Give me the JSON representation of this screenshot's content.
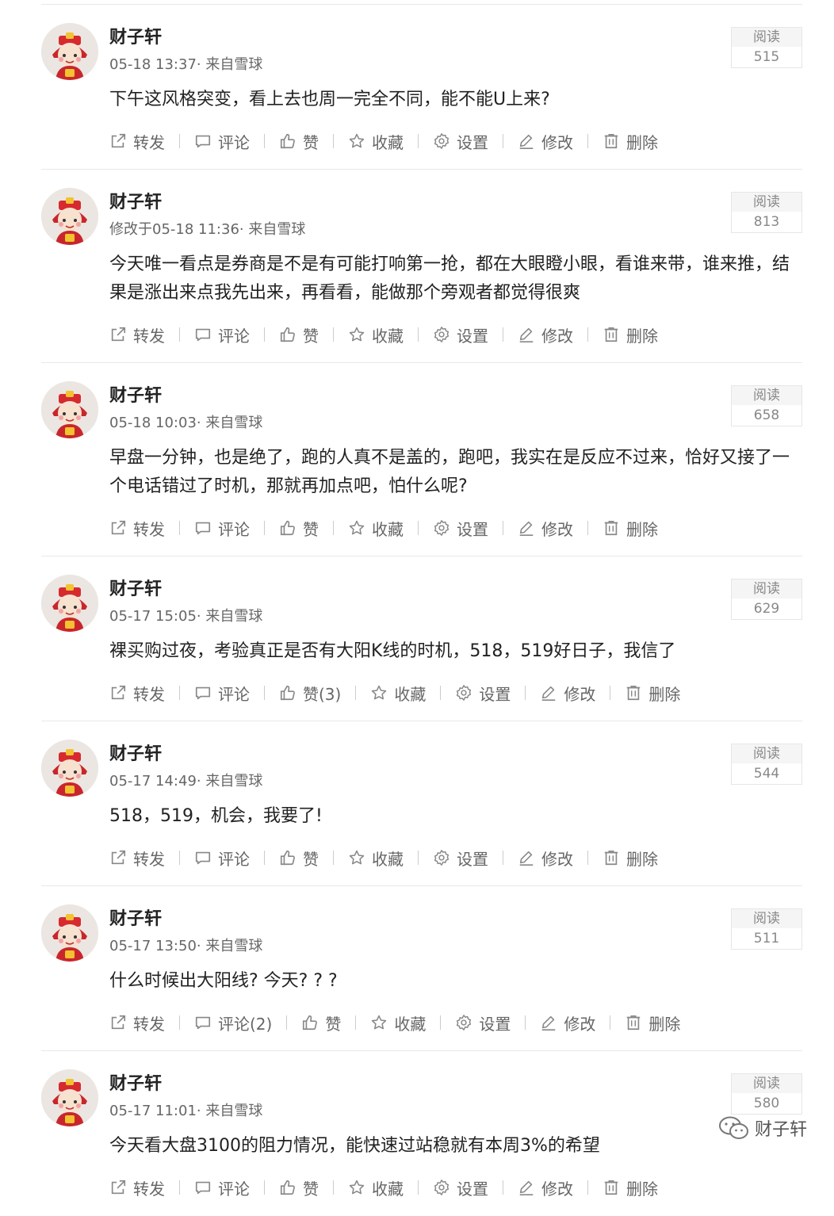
{
  "actions": {
    "forward": "转发",
    "comment": "评论",
    "like": "赞",
    "favorite": "收藏",
    "settings": "设置",
    "edit": "修改",
    "delete": "删除"
  },
  "reads_label": "阅读",
  "watermark": "财子轩",
  "posts": [
    {
      "author": "财子轩",
      "time": "05-18 13:37",
      "source": "· 来自雪球",
      "reads": "515",
      "content": "下午这风格突变，看上去也周一完全不同，能不能U上来?",
      "comment_label": "评论",
      "like_label": "赞"
    },
    {
      "author": "财子轩",
      "time": "修改于05-18 11:36",
      "source": "· 来自雪球",
      "reads": "813",
      "content": "今天唯一看点是券商是不是有可能打响第一抢，都在大眼瞪小眼，看谁来带，谁来推，结果是涨出来点我先出来，再看看，能做那个旁观者都觉得很爽",
      "comment_label": "评论",
      "like_label": "赞"
    },
    {
      "author": "财子轩",
      "time": "05-18 10:03",
      "source": "· 来自雪球",
      "reads": "658",
      "content": "早盘一分钟，也是绝了，跑的人真不是盖的，跑吧，我实在是反应不过来，恰好又接了一个电话错过了时机，那就再加点吧，怕什么呢?",
      "comment_label": "评论",
      "like_label": "赞"
    },
    {
      "author": "财子轩",
      "time": "05-17 15:05",
      "source": "· 来自雪球",
      "reads": "629",
      "content": "裸买购过夜，考验真正是否有大阳K线的时机，518，519好日子，我信了",
      "comment_label": "评论",
      "like_label": "赞(3)"
    },
    {
      "author": "财子轩",
      "time": "05-17 14:49",
      "source": "· 来自雪球",
      "reads": "544",
      "content": "518，519，机会，我要了!",
      "comment_label": "评论",
      "like_label": "赞"
    },
    {
      "author": "财子轩",
      "time": "05-17 13:50",
      "source": "· 来自雪球",
      "reads": "511",
      "content": "什么时候出大阳线? 今天? ? ?",
      "comment_label": "评论(2)",
      "like_label": "赞"
    },
    {
      "author": "财子轩",
      "time": "05-17 11:01",
      "source": "· 来自雪球",
      "reads": "580",
      "content": "今天看大盘3100的阻力情况，能快速过站稳就有本周3%的希望",
      "comment_label": "评论",
      "like_label": "赞"
    }
  ]
}
